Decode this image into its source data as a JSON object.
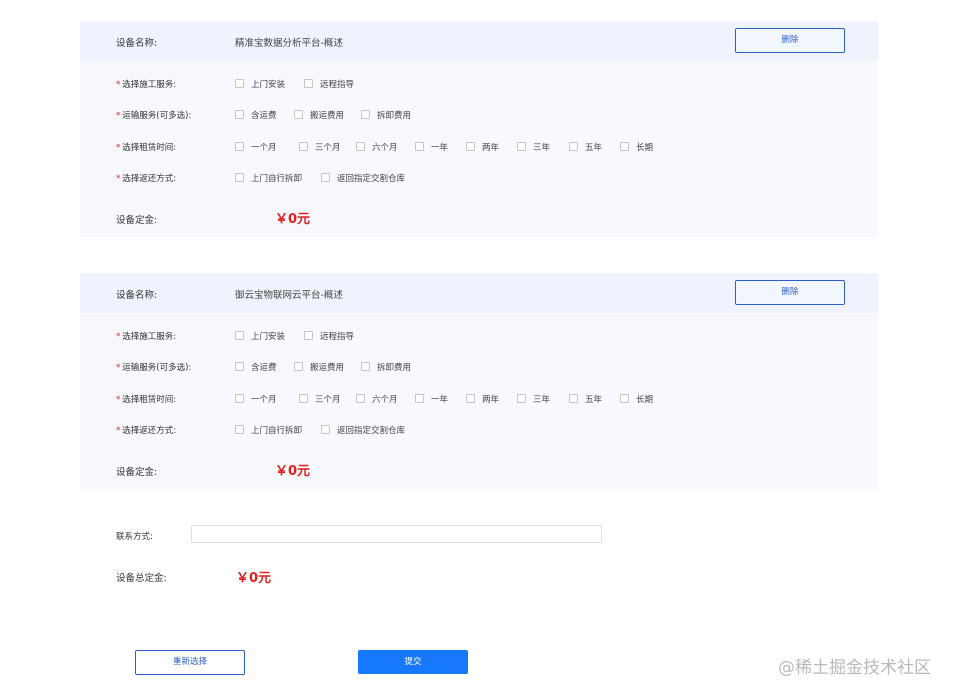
{
  "devices": [
    {
      "name_label": "设备名称:",
      "name_value": "精准宝数据分析平台-概述",
      "delete_label": "删除",
      "rows": [
        {
          "label": "选择施工服务:",
          "options": [
            "上门安装",
            "远程指导"
          ]
        },
        {
          "label": "运输服务(可多选):",
          "options": [
            "含运费",
            "搬运费用",
            "拆卸费用"
          ]
        },
        {
          "label": "选择租赁时间:",
          "options": [
            "一个月",
            "三个月",
            "六个月",
            "一年",
            "两年",
            "三年",
            "五年",
            "长期"
          ]
        },
        {
          "label": "选择返还方式:",
          "options": [
            "上门自行拆卸",
            "返回指定交割仓库"
          ]
        }
      ],
      "deposit_label": "设备定金:",
      "deposit_value": "￥0元"
    },
    {
      "name_label": "设备名称:",
      "name_value": "御云宝物联网云平台-概述",
      "delete_label": "删除",
      "rows": [
        {
          "label": "选择施工服务:",
          "options": [
            "上门安装",
            "远程指导"
          ]
        },
        {
          "label": "运输服务(可多选):",
          "options": [
            "含运费",
            "搬运费用",
            "拆卸费用"
          ]
        },
        {
          "label": "选择租赁时间:",
          "options": [
            "一个月",
            "三个月",
            "六个月",
            "一年",
            "两年",
            "三年",
            "五年",
            "长期"
          ]
        },
        {
          "label": "选择返还方式:",
          "options": [
            "上门自行拆卸",
            "返回指定交割仓库"
          ]
        }
      ],
      "deposit_label": "设备定金:",
      "deposit_value": "￥0元"
    }
  ],
  "required_mark": "*",
  "contact": {
    "label": "联系方式:",
    "value": "",
    "placeholder": ""
  },
  "total": {
    "label": "设备总定金:",
    "value": "￥0元"
  },
  "buttons": {
    "reset": "重新选择",
    "submit": "提交"
  },
  "watermark": "@稀土掘金技术社区",
  "colors": {
    "accent": "#1677ff",
    "border_blue": "#2c5fc9",
    "price_red": "#e02020",
    "card_bg": "#f7f9fe",
    "card_head_bg": "#eff3fd"
  }
}
